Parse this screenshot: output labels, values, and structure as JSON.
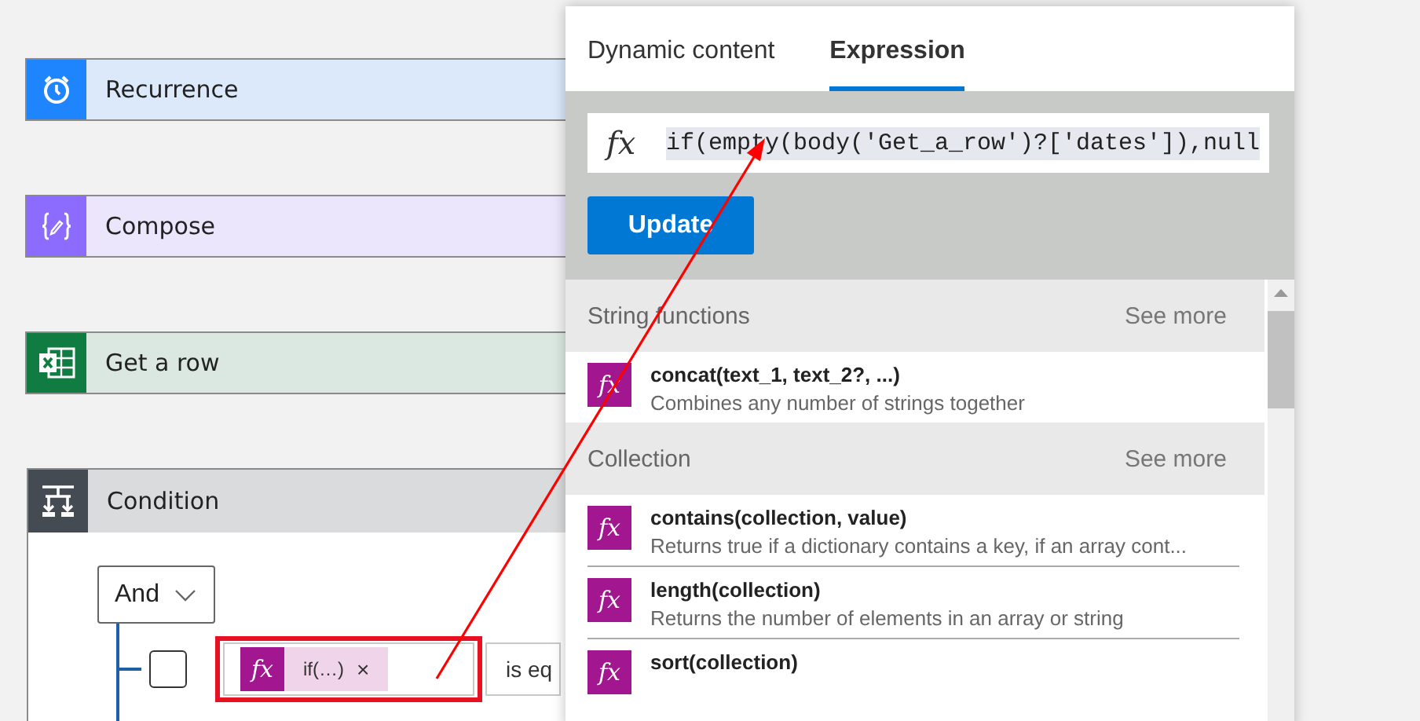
{
  "flow_steps": [
    {
      "title": "Recurrence",
      "kind": "trigger"
    },
    {
      "title": "Compose",
      "kind": "compose"
    },
    {
      "title": "Get a row",
      "kind": "excel"
    }
  ],
  "condition": {
    "title": "Condition",
    "group_operator": "And",
    "rows": [
      {
        "checked": false,
        "token": {
          "icon": "fx",
          "label": "if(…)",
          "remove": "×"
        },
        "operator": "is eq"
      }
    ]
  },
  "expression_panel": {
    "tabs": [
      {
        "label": "Dynamic content",
        "selected": false
      },
      {
        "label": "Expression",
        "selected": true
      }
    ],
    "expression": {
      "icon": "fx",
      "value": "if(empty(body('Get_a_row')?['dates']),null"
    },
    "update_button": "Update",
    "sections": [
      {
        "title": "String functions",
        "see_more": "See more",
        "functions": [
          {
            "icon": "fx",
            "signature": "concat(text_1, text_2?, ...)",
            "description": "Combines any number of strings together"
          }
        ]
      },
      {
        "title": "Collection",
        "see_more": "See more",
        "functions": [
          {
            "icon": "fx",
            "signature": "contains(collection, value)",
            "description": "Returns true if a dictionary contains a key, if an array cont..."
          },
          {
            "icon": "fx",
            "signature": "length(collection)",
            "description": "Returns the number of elements in an array or string"
          },
          {
            "icon": "fx",
            "signature": "sort(collection)"
          }
        ]
      }
    ]
  }
}
